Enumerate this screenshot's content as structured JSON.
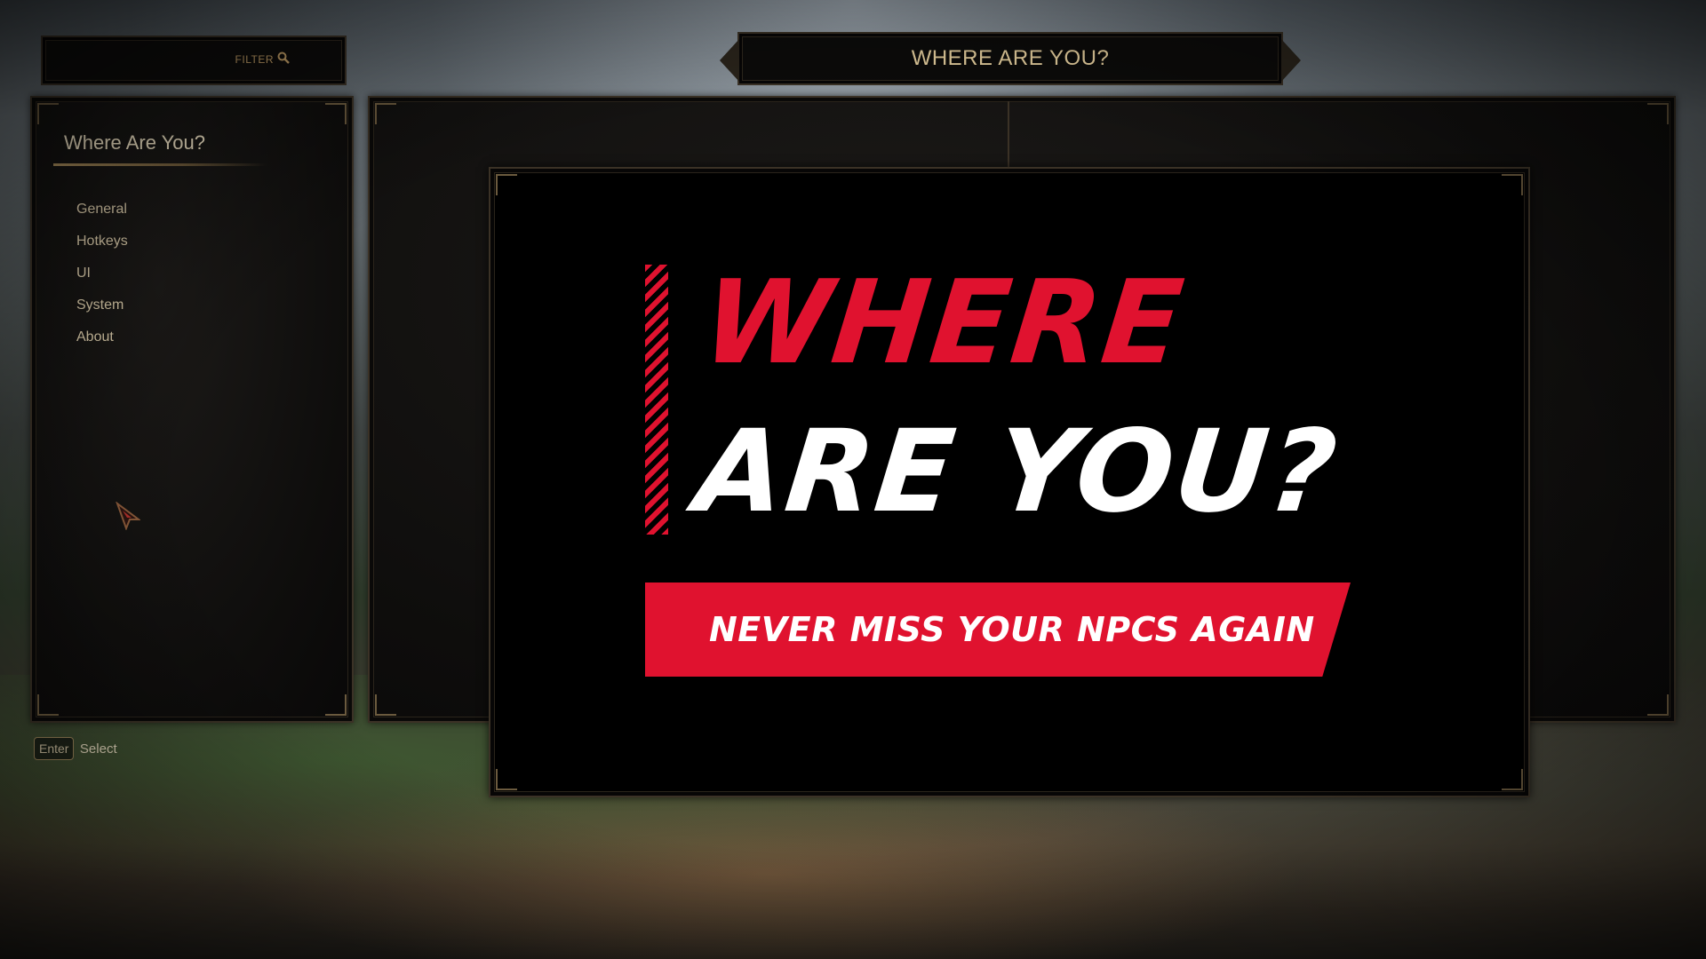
{
  "filter": {
    "label": "FILTER",
    "icon": "search-icon"
  },
  "header": {
    "title": "WHERE ARE YOU?"
  },
  "sidebar": {
    "mod_title": "Where Are You?",
    "items": [
      {
        "label": "General"
      },
      {
        "label": "Hotkeys"
      },
      {
        "label": "UI"
      },
      {
        "label": "System"
      },
      {
        "label": "About"
      }
    ]
  },
  "banner": {
    "line1": "WHERE",
    "line2": "ARE YOU?",
    "tagline": "NEVER MISS YOUR NPCS AGAIN",
    "accent_color": "#e0122f"
  },
  "hint": {
    "key": "Enter",
    "action": "Select"
  },
  "colors": {
    "gold_text": "#e6cf9e",
    "menu_text": "#d8c9a8",
    "frame_border": "#3b3226"
  }
}
